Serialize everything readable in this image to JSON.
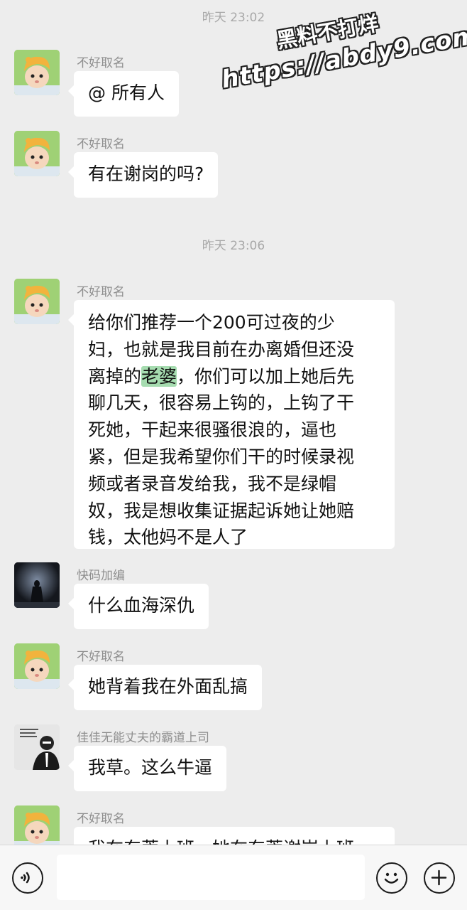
{
  "timestamps": [
    "昨天 23:02",
    "昨天 23:06"
  ],
  "watermark": {
    "line1": "黑料不打烊",
    "line2": "https://abdy9.com"
  },
  "messages": [
    {
      "sender": "不好取名",
      "avatar": "baby-avatar",
      "text": "@ 所有人"
    },
    {
      "sender": "不好取名",
      "avatar": "baby-avatar",
      "text": "有在谢岗的吗?"
    },
    {
      "sender": "不好取名",
      "avatar": "baby-avatar",
      "lines": [
        "给你们推荐一个200可过夜的少",
        "妇，也就是我目前在办离婚但还没",
        "离掉的",
        "老婆",
        "，你们可以加上她后先",
        "聊几天，很容易上钩的，上钩了干",
        "死她，干起来很骚很浪的，逼也",
        "紧，但是我希望你们干的时候录视",
        "频或者录音发给我，我不是绿帽",
        "奴，我是想收集证据起诉她让她赔",
        "钱，太他妈不是人了"
      ]
    },
    {
      "sender": "快码加编",
      "avatar": "dark-figure-avatar",
      "text": "什么血海深仇"
    },
    {
      "sender": "不好取名",
      "avatar": "baby-avatar",
      "text": "她背着我在外面乱搞"
    },
    {
      "sender": "佳佳无能丈夫的霸道上司",
      "avatar": "meme-avatar",
      "text": "我草。这么牛逼"
    },
    {
      "sender": "不好取名",
      "avatar": "baby-avatar",
      "text": "我在东莞上班，她在东莞谢岗上班"
    }
  ],
  "input_bar": {
    "voice_icon": "voice-icon",
    "emoji_icon": "emoji-icon",
    "add_icon": "plus-icon"
  },
  "colors": {
    "background": "#ededed",
    "bubble": "#ffffff",
    "highlight": "#a6dcb0",
    "avatar_green": "#9fd175"
  }
}
